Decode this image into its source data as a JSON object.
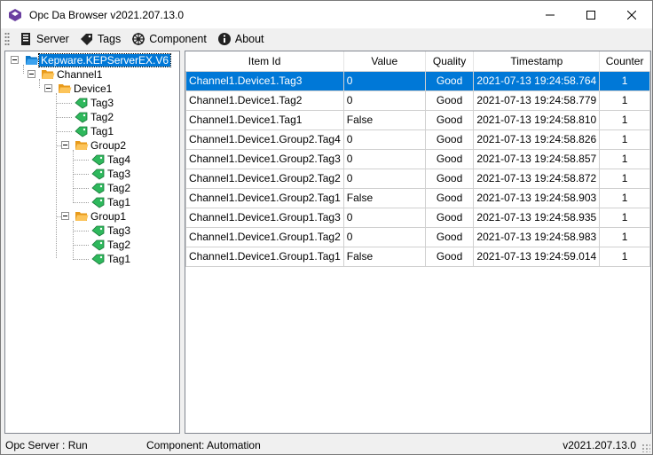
{
  "window": {
    "title": "Opc Da Browser v2021.207.13.0"
  },
  "menu": {
    "server": "Server",
    "tags": "Tags",
    "component": "Component",
    "about": "About"
  },
  "tree": {
    "server": "Kepware.KEPServerEX.V6",
    "channel": "Channel1",
    "device": "Device1",
    "device_tags": [
      "Tag3",
      "Tag2",
      "Tag1"
    ],
    "group2": "Group2",
    "group2_tags": [
      "Tag4",
      "Tag3",
      "Tag2",
      "Tag1"
    ],
    "group1": "Group1",
    "group1_tags": [
      "Tag3",
      "Tag2",
      "Tag1"
    ]
  },
  "grid": {
    "columns": [
      "Item Id",
      "Value",
      "Quality",
      "Timestamp",
      "Counter"
    ],
    "rows": [
      [
        "Channel1.Device1.Tag3",
        "0",
        "Good",
        "2021-07-13 19:24:58.764",
        "1"
      ],
      [
        "Channel1.Device1.Tag2",
        "0",
        "Good",
        "2021-07-13 19:24:58.779",
        "1"
      ],
      [
        "Channel1.Device1.Tag1",
        "False",
        "Good",
        "2021-07-13 19:24:58.810",
        "1"
      ],
      [
        "Channel1.Device1.Group2.Tag4",
        "0",
        "Good",
        "2021-07-13 19:24:58.826",
        "1"
      ],
      [
        "Channel1.Device1.Group2.Tag3",
        "0",
        "Good",
        "2021-07-13 19:24:58.857",
        "1"
      ],
      [
        "Channel1.Device1.Group2.Tag2",
        "0",
        "Good",
        "2021-07-13 19:24:58.872",
        "1"
      ],
      [
        "Channel1.Device1.Group2.Tag1",
        "False",
        "Good",
        "2021-07-13 19:24:58.903",
        "1"
      ],
      [
        "Channel1.Device1.Group1.Tag3",
        "0",
        "Good",
        "2021-07-13 19:24:58.935",
        "1"
      ],
      [
        "Channel1.Device1.Group1.Tag2",
        "0",
        "Good",
        "2021-07-13 19:24:58.983",
        "1"
      ],
      [
        "Channel1.Device1.Group1.Tag1",
        "False",
        "Good",
        "2021-07-13 19:24:59.014",
        "1"
      ]
    ]
  },
  "status": {
    "server": "Opc Server : Run",
    "component": "Component: Automation",
    "version": "v2021.207.13.0"
  },
  "colors": {
    "selection": "#0078d7",
    "folder": "#f5a623",
    "tag": "#2ecc71"
  }
}
